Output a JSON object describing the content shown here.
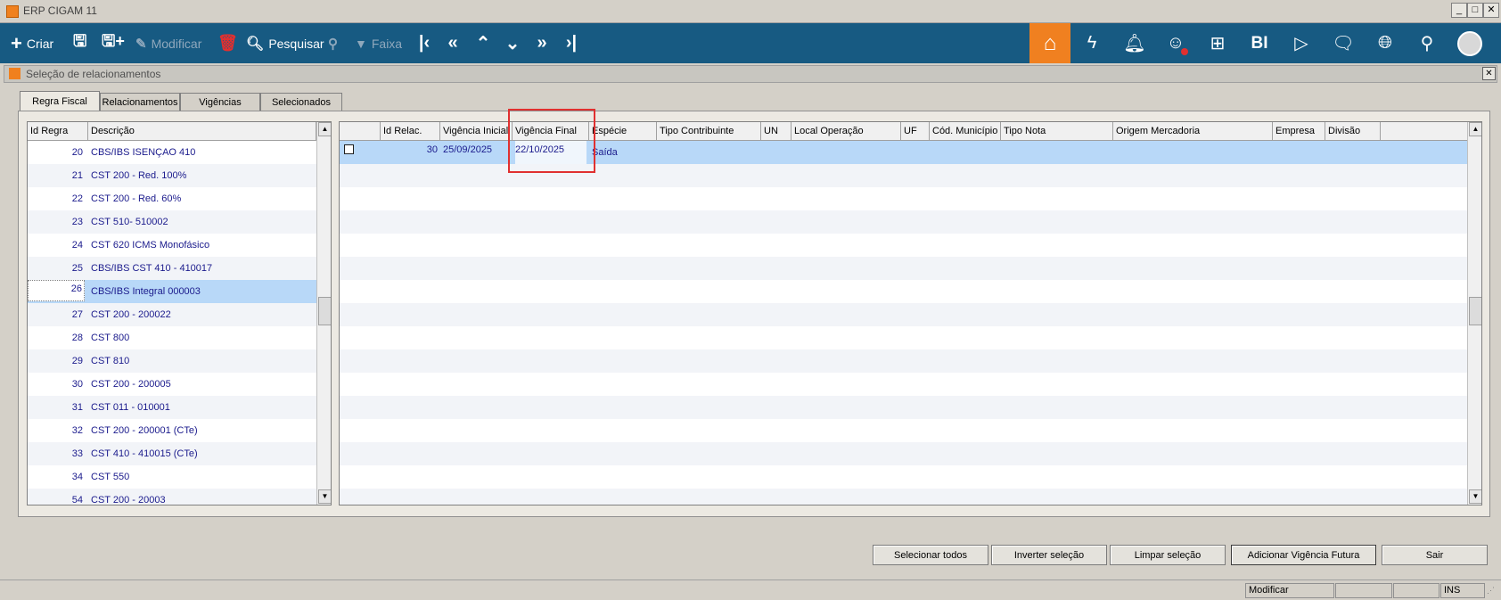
{
  "window": {
    "title": "ERP CIGAM 11"
  },
  "toolbar": {
    "criar": "Criar",
    "modificar": "Modificar",
    "pesquisar": "Pesquisar",
    "faixa": "Faixa",
    "bi": "BI"
  },
  "subwindow": {
    "title": "Seleção de relacionamentos"
  },
  "tabs": [
    "Regra Fiscal",
    "Relacionamentos",
    "Vigências",
    "Selecionados"
  ],
  "left_grid": {
    "headers": [
      "Id Regra",
      "Descrição"
    ],
    "rows": [
      {
        "id": "20",
        "desc": "CBS/IBS ISENÇAO 410"
      },
      {
        "id": "21",
        "desc": "CST 200 - Red. 100%"
      },
      {
        "id": "22",
        "desc": "CST 200 - Red. 60%"
      },
      {
        "id": "23",
        "desc": "CST 510- 510002"
      },
      {
        "id": "24",
        "desc": "CST 620 ICMS Monofásico"
      },
      {
        "id": "25",
        "desc": "CBS/IBS CST 410 - 410017"
      },
      {
        "id": "26",
        "desc": "CBS/IBS Integral 000003"
      },
      {
        "id": "27",
        "desc": "CST 200 - 200022"
      },
      {
        "id": "28",
        "desc": "CST 800"
      },
      {
        "id": "29",
        "desc": "CST 810"
      },
      {
        "id": "30",
        "desc": "CST 200 - 200005"
      },
      {
        "id": "31",
        "desc": "CST 011 - 010001"
      },
      {
        "id": "32",
        "desc": "CST 200 - 200001 (CTe)"
      },
      {
        "id": "33",
        "desc": "CST 410 - 410015 (CTe)"
      },
      {
        "id": "34",
        "desc": "CST 550"
      },
      {
        "id": "54",
        "desc": "CST 200 - 20003"
      }
    ],
    "selected_index": 6
  },
  "right_grid": {
    "headers": [
      "",
      "Id Relac.",
      "Vigência Inicial",
      "Vigência Final",
      "Espécie",
      "Tipo Contribuinte",
      "UN",
      "Local Operação",
      "UF",
      "Cód. Município",
      "Tipo Nota",
      "Origem Mercadoria",
      "Empresa",
      "Divisão"
    ],
    "rows": [
      {
        "checked": false,
        "id_relac": "30",
        "vig_inicial": "25/09/2025",
        "vig_final": "22/10/2025",
        "especie": "Saída"
      }
    ]
  },
  "buttons": {
    "selecionar_todos": "Selecionar todos",
    "inverter_selecao": "Inverter seleção",
    "limpar_selecao": "Limpar seleção",
    "adicionar_vigencia": "Adicionar Vigência Futura",
    "sair": "Sair"
  },
  "statusbar": {
    "mode": "Modificar",
    "ins": "INS"
  }
}
